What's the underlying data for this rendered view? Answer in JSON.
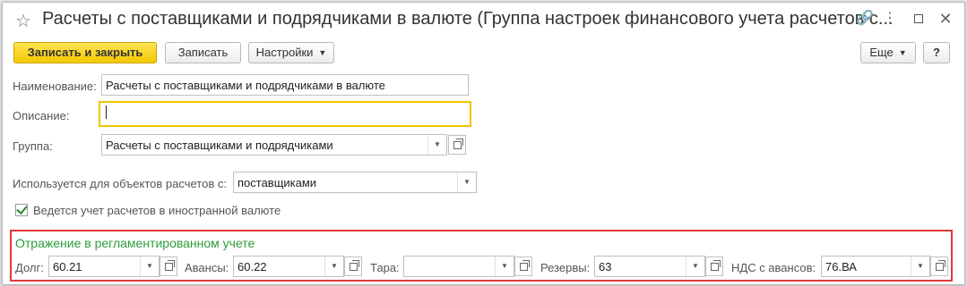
{
  "window": {
    "title": "Расчеты с поставщиками и подрядчиками в валюте (Группа настроек финансового учета расчетов с..."
  },
  "toolbar": {
    "save_close_label": "Записать и закрыть",
    "save_label": "Записать",
    "settings_label": "Настройки",
    "more_label": "Еще",
    "help_label": "?"
  },
  "form": {
    "name_label": "Наименование:",
    "name_value": "Расчеты с поставщиками и подрядчиками в валюте",
    "description_label": "Описание:",
    "description_value": "",
    "group_label": "Группа:",
    "group_value": "Расчеты с поставщиками и подрядчиками",
    "used_for_label": "Используется для объектов расчетов с:",
    "used_for_value": "поставщиками",
    "foreign_currency_label": "Ведется учет расчетов в иностранной валюте",
    "foreign_currency_checked": true
  },
  "accounting": {
    "title": "Отражение в регламентированном учете",
    "debt_label": "Долг:",
    "debt_value": "60.21",
    "advances_label": "Авансы:",
    "advances_value": "60.22",
    "tara_label": "Тара:",
    "tara_value": "",
    "reserves_label": "Резервы:",
    "reserves_value": "63",
    "vat_label": "НДС с авансов:",
    "vat_value": "76.ВА"
  },
  "colors": {
    "primary_button": "#f5c800",
    "group_border": "#e0393a",
    "group_title": "#2e9c3a",
    "focus_border": "#f0c400"
  }
}
